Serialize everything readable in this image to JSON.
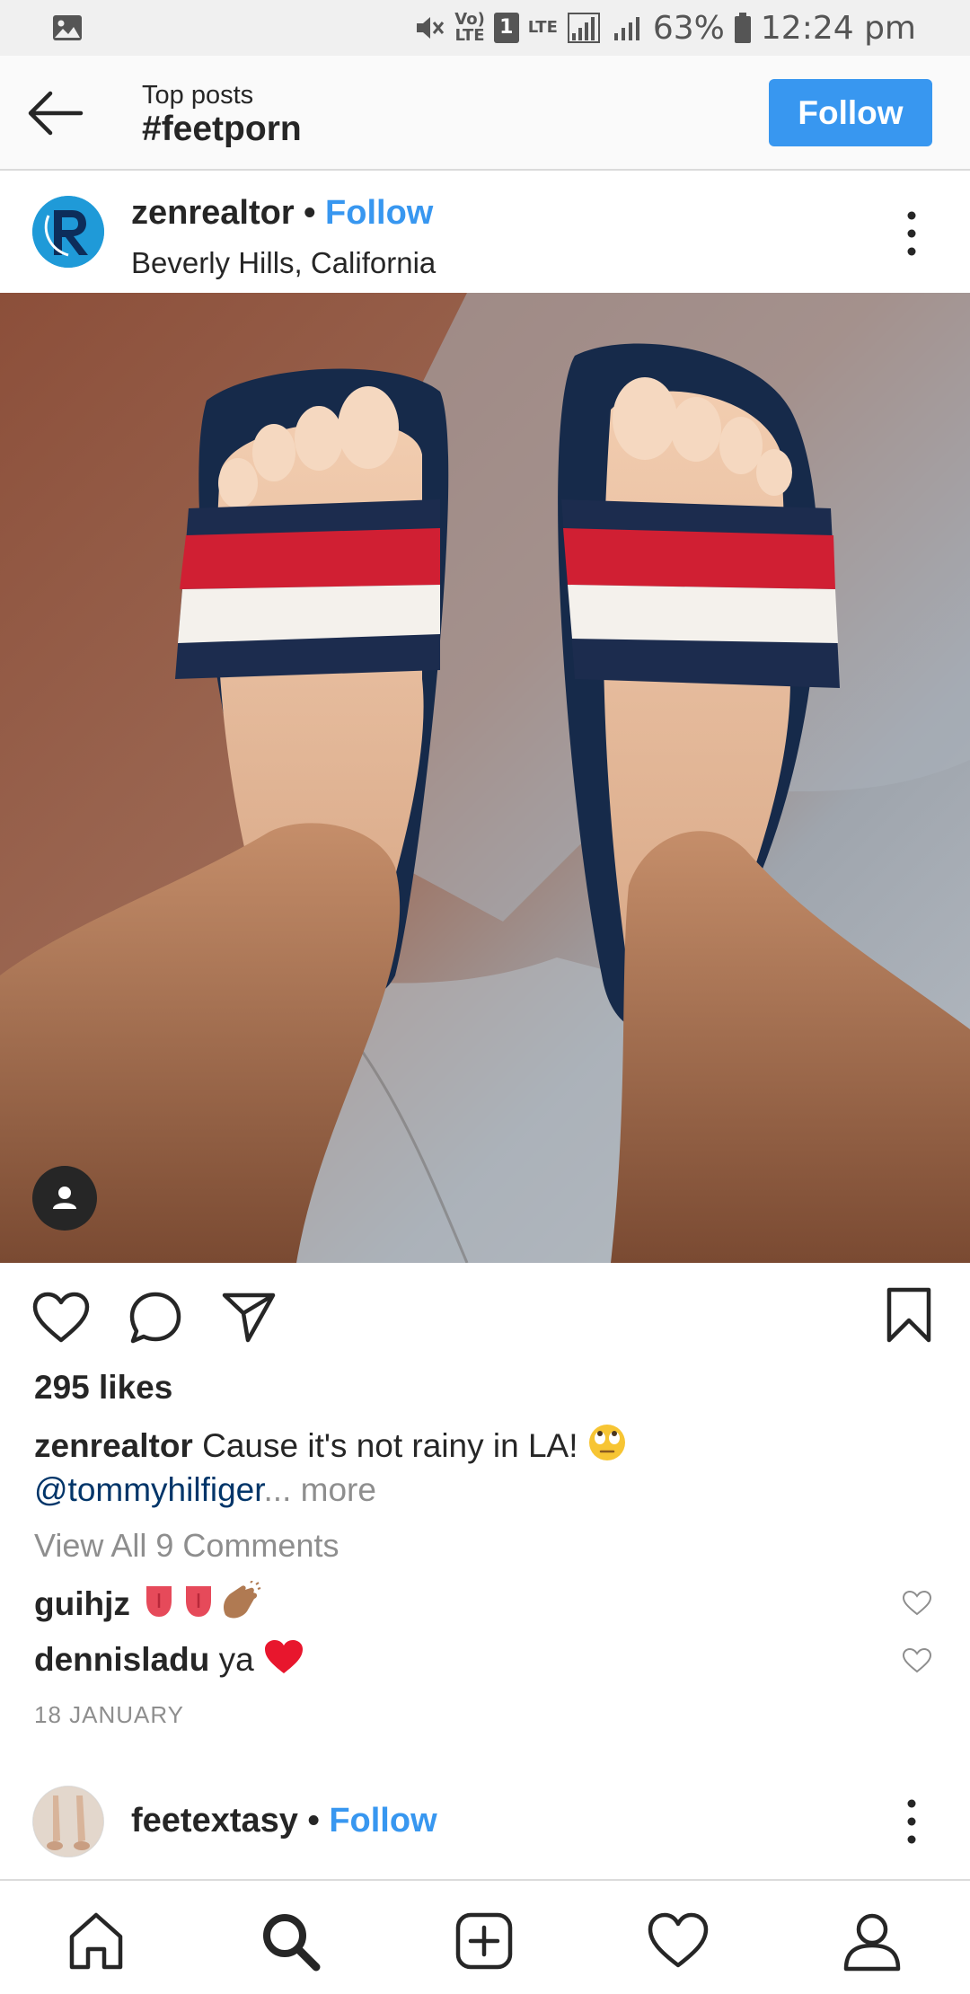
{
  "status_bar": {
    "volte": "Vo)",
    "lte": "LTE",
    "sim": "1",
    "lte2": "LTE",
    "battery": "63%",
    "time": "12:24 pm"
  },
  "header": {
    "subtitle": "Top posts",
    "title": "#feetporn",
    "follow_label": "Follow"
  },
  "post": {
    "username": "zenrealtor",
    "separator": " • ",
    "follow_label": "Follow",
    "location": "Beverly Hills, California",
    "likes": "295 likes",
    "caption_user": "zenrealtor",
    "caption_text": " Cause it's not rainy in LA! ",
    "caption_mention": "@tommyhilfiger",
    "caption_more": "... more",
    "view_all": "View All 9 Comments",
    "comments": [
      {
        "user": "guihjz",
        "text": " "
      },
      {
        "user": "dennisladu",
        "text": " ya "
      }
    ],
    "date": "18 JANUARY"
  },
  "next_post": {
    "username": "feetextasy",
    "separator": " • ",
    "follow_label": "Follow"
  },
  "icons": {
    "back": "arrow-left",
    "more": "three-dots-vertical",
    "like": "heart",
    "comment": "speech-bubble",
    "share": "paper-plane",
    "save": "bookmark",
    "tag": "user",
    "nav": [
      "home",
      "search",
      "add",
      "heart",
      "profile"
    ]
  },
  "colors": {
    "accent": "#3897f0",
    "mention": "#003569",
    "muted": "#8e8e8e"
  }
}
